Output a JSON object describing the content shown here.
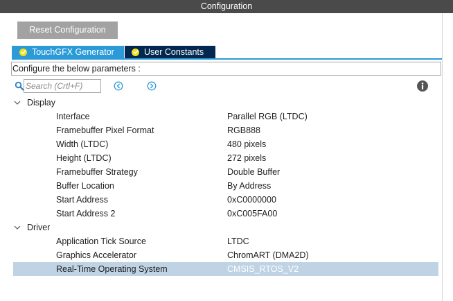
{
  "window": {
    "title": "Configuration"
  },
  "toolbar": {
    "reset_label": "Reset Configuration"
  },
  "tabs": [
    {
      "label": "TouchGFX Generator",
      "active": true
    },
    {
      "label": "User Constants",
      "active": false
    }
  ],
  "description": "Configure the below parameters :",
  "search": {
    "placeholder": "Search (Crtl+F)"
  },
  "icons": {
    "search": "search-icon",
    "prev": "circle-left-icon",
    "next": "circle-right-icon",
    "info": "info-icon",
    "tab_check": "check-circle-icon",
    "expand": "chevron-down-icon"
  },
  "colors": {
    "title_bar": "#4a4a4a",
    "reset_button": "#a2a2a2",
    "tab_active": "#2b9ad8",
    "tab_inactive": "#02284f",
    "tab_check": "#f2e21c",
    "selection": "#bfd3e5",
    "nav_icon": "#2b9ad8",
    "info_icon": "#555555"
  },
  "groups": [
    {
      "label": "Display",
      "expanded": true,
      "params": [
        {
          "name": "Interface",
          "value": "Parallel RGB (LTDC)"
        },
        {
          "name": "Framebuffer Pixel Format",
          "value": "RGB888"
        },
        {
          "name": "Width (LTDC)",
          "value": "480 pixels"
        },
        {
          "name": "Height (LTDC)",
          "value": "272 pixels"
        },
        {
          "name": "Framebuffer Strategy",
          "value": "Double Buffer"
        },
        {
          "name": "Buffer Location",
          "value": "By Address"
        },
        {
          "name": "Start Address",
          "value": "0xC0000000"
        },
        {
          "name": "Start Address 2",
          "value": "0xC005FA00"
        }
      ]
    },
    {
      "label": "Driver",
      "expanded": true,
      "params": [
        {
          "name": "Application Tick Source",
          "value": "LTDC"
        },
        {
          "name": "Graphics Accelerator",
          "value": "ChromART (DMA2D)"
        },
        {
          "name": "Real-Time Operating System",
          "value": "CMSIS_RTOS_V2",
          "selected": true
        }
      ]
    }
  ]
}
